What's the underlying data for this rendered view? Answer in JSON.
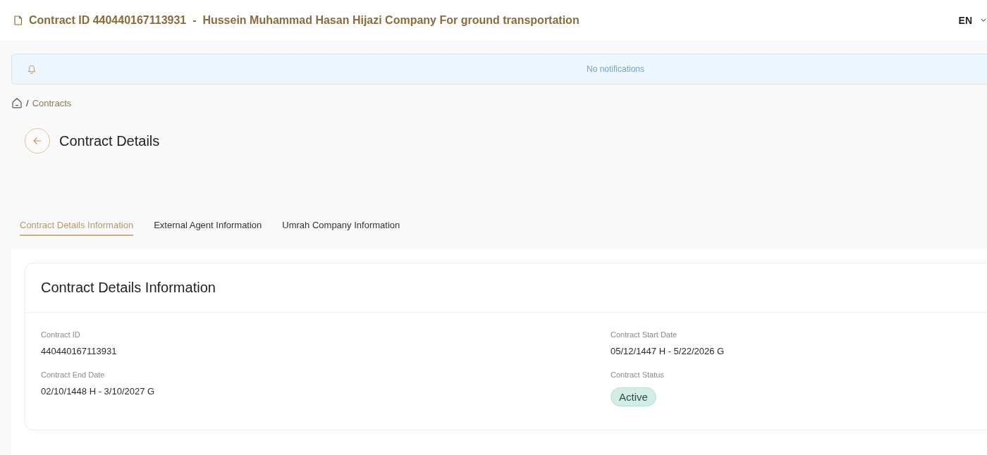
{
  "header": {
    "title": "Contract ID 440440167113931  -  Hussein Muhammad Hasan Hijazi Company For ground transportation",
    "language": "EN"
  },
  "notifications": {
    "message": "No notifications"
  },
  "breadcrumb": {
    "separator": "/",
    "items": [
      "Contracts"
    ]
  },
  "page_title": "Contract Details",
  "tabs": [
    {
      "label": "Contract Details Information",
      "selected": true
    },
    {
      "label": "External Agent Information",
      "selected": false
    },
    {
      "label": "Umrah Company Information",
      "selected": false
    }
  ],
  "section": {
    "title": "Contract Details Information",
    "fields": [
      {
        "kind": "text",
        "label": "Contract ID",
        "value": "440440167113931"
      },
      {
        "kind": "text",
        "label": "Contract Start Date",
        "value": "05/12/1447 H - 5/22/2026 G"
      },
      {
        "kind": "text",
        "label": "Contract End Date",
        "value": "02/10/1448 H - 3/10/2027 G"
      },
      {
        "kind": "badge",
        "label": "Contract Status",
        "value": "Active"
      }
    ]
  }
}
